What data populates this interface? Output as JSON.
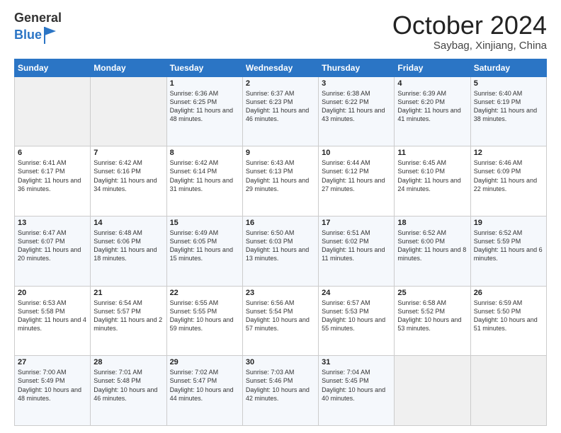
{
  "header": {
    "logo_general": "General",
    "logo_blue": "Blue",
    "month_title": "October 2024",
    "location": "Saybag, Xinjiang, China"
  },
  "days_of_week": [
    "Sunday",
    "Monday",
    "Tuesday",
    "Wednesday",
    "Thursday",
    "Friday",
    "Saturday"
  ],
  "weeks": [
    [
      {
        "day": "",
        "sunrise": "",
        "sunset": "",
        "daylight": ""
      },
      {
        "day": "",
        "sunrise": "",
        "sunset": "",
        "daylight": ""
      },
      {
        "day": "1",
        "sunrise": "Sunrise: 6:36 AM",
        "sunset": "Sunset: 6:25 PM",
        "daylight": "Daylight: 11 hours and 48 minutes."
      },
      {
        "day": "2",
        "sunrise": "Sunrise: 6:37 AM",
        "sunset": "Sunset: 6:23 PM",
        "daylight": "Daylight: 11 hours and 46 minutes."
      },
      {
        "day": "3",
        "sunrise": "Sunrise: 6:38 AM",
        "sunset": "Sunset: 6:22 PM",
        "daylight": "Daylight: 11 hours and 43 minutes."
      },
      {
        "day": "4",
        "sunrise": "Sunrise: 6:39 AM",
        "sunset": "Sunset: 6:20 PM",
        "daylight": "Daylight: 11 hours and 41 minutes."
      },
      {
        "day": "5",
        "sunrise": "Sunrise: 6:40 AM",
        "sunset": "Sunset: 6:19 PM",
        "daylight": "Daylight: 11 hours and 38 minutes."
      }
    ],
    [
      {
        "day": "6",
        "sunrise": "Sunrise: 6:41 AM",
        "sunset": "Sunset: 6:17 PM",
        "daylight": "Daylight: 11 hours and 36 minutes."
      },
      {
        "day": "7",
        "sunrise": "Sunrise: 6:42 AM",
        "sunset": "Sunset: 6:16 PM",
        "daylight": "Daylight: 11 hours and 34 minutes."
      },
      {
        "day": "8",
        "sunrise": "Sunrise: 6:42 AM",
        "sunset": "Sunset: 6:14 PM",
        "daylight": "Daylight: 11 hours and 31 minutes."
      },
      {
        "day": "9",
        "sunrise": "Sunrise: 6:43 AM",
        "sunset": "Sunset: 6:13 PM",
        "daylight": "Daylight: 11 hours and 29 minutes."
      },
      {
        "day": "10",
        "sunrise": "Sunrise: 6:44 AM",
        "sunset": "Sunset: 6:12 PM",
        "daylight": "Daylight: 11 hours and 27 minutes."
      },
      {
        "day": "11",
        "sunrise": "Sunrise: 6:45 AM",
        "sunset": "Sunset: 6:10 PM",
        "daylight": "Daylight: 11 hours and 24 minutes."
      },
      {
        "day": "12",
        "sunrise": "Sunrise: 6:46 AM",
        "sunset": "Sunset: 6:09 PM",
        "daylight": "Daylight: 11 hours and 22 minutes."
      }
    ],
    [
      {
        "day": "13",
        "sunrise": "Sunrise: 6:47 AM",
        "sunset": "Sunset: 6:07 PM",
        "daylight": "Daylight: 11 hours and 20 minutes."
      },
      {
        "day": "14",
        "sunrise": "Sunrise: 6:48 AM",
        "sunset": "Sunset: 6:06 PM",
        "daylight": "Daylight: 11 hours and 18 minutes."
      },
      {
        "day": "15",
        "sunrise": "Sunrise: 6:49 AM",
        "sunset": "Sunset: 6:05 PM",
        "daylight": "Daylight: 11 hours and 15 minutes."
      },
      {
        "day": "16",
        "sunrise": "Sunrise: 6:50 AM",
        "sunset": "Sunset: 6:03 PM",
        "daylight": "Daylight: 11 hours and 13 minutes."
      },
      {
        "day": "17",
        "sunrise": "Sunrise: 6:51 AM",
        "sunset": "Sunset: 6:02 PM",
        "daylight": "Daylight: 11 hours and 11 minutes."
      },
      {
        "day": "18",
        "sunrise": "Sunrise: 6:52 AM",
        "sunset": "Sunset: 6:00 PM",
        "daylight": "Daylight: 11 hours and 8 minutes."
      },
      {
        "day": "19",
        "sunrise": "Sunrise: 6:52 AM",
        "sunset": "Sunset: 5:59 PM",
        "daylight": "Daylight: 11 hours and 6 minutes."
      }
    ],
    [
      {
        "day": "20",
        "sunrise": "Sunrise: 6:53 AM",
        "sunset": "Sunset: 5:58 PM",
        "daylight": "Daylight: 11 hours and 4 minutes."
      },
      {
        "day": "21",
        "sunrise": "Sunrise: 6:54 AM",
        "sunset": "Sunset: 5:57 PM",
        "daylight": "Daylight: 11 hours and 2 minutes."
      },
      {
        "day": "22",
        "sunrise": "Sunrise: 6:55 AM",
        "sunset": "Sunset: 5:55 PM",
        "daylight": "Daylight: 10 hours and 59 minutes."
      },
      {
        "day": "23",
        "sunrise": "Sunrise: 6:56 AM",
        "sunset": "Sunset: 5:54 PM",
        "daylight": "Daylight: 10 hours and 57 minutes."
      },
      {
        "day": "24",
        "sunrise": "Sunrise: 6:57 AM",
        "sunset": "Sunset: 5:53 PM",
        "daylight": "Daylight: 10 hours and 55 minutes."
      },
      {
        "day": "25",
        "sunrise": "Sunrise: 6:58 AM",
        "sunset": "Sunset: 5:52 PM",
        "daylight": "Daylight: 10 hours and 53 minutes."
      },
      {
        "day": "26",
        "sunrise": "Sunrise: 6:59 AM",
        "sunset": "Sunset: 5:50 PM",
        "daylight": "Daylight: 10 hours and 51 minutes."
      }
    ],
    [
      {
        "day": "27",
        "sunrise": "Sunrise: 7:00 AM",
        "sunset": "Sunset: 5:49 PM",
        "daylight": "Daylight: 10 hours and 48 minutes."
      },
      {
        "day": "28",
        "sunrise": "Sunrise: 7:01 AM",
        "sunset": "Sunset: 5:48 PM",
        "daylight": "Daylight: 10 hours and 46 minutes."
      },
      {
        "day": "29",
        "sunrise": "Sunrise: 7:02 AM",
        "sunset": "Sunset: 5:47 PM",
        "daylight": "Daylight: 10 hours and 44 minutes."
      },
      {
        "day": "30",
        "sunrise": "Sunrise: 7:03 AM",
        "sunset": "Sunset: 5:46 PM",
        "daylight": "Daylight: 10 hours and 42 minutes."
      },
      {
        "day": "31",
        "sunrise": "Sunrise: 7:04 AM",
        "sunset": "Sunset: 5:45 PM",
        "daylight": "Daylight: 10 hours and 40 minutes."
      },
      {
        "day": "",
        "sunrise": "",
        "sunset": "",
        "daylight": ""
      },
      {
        "day": "",
        "sunrise": "",
        "sunset": "",
        "daylight": ""
      }
    ]
  ]
}
